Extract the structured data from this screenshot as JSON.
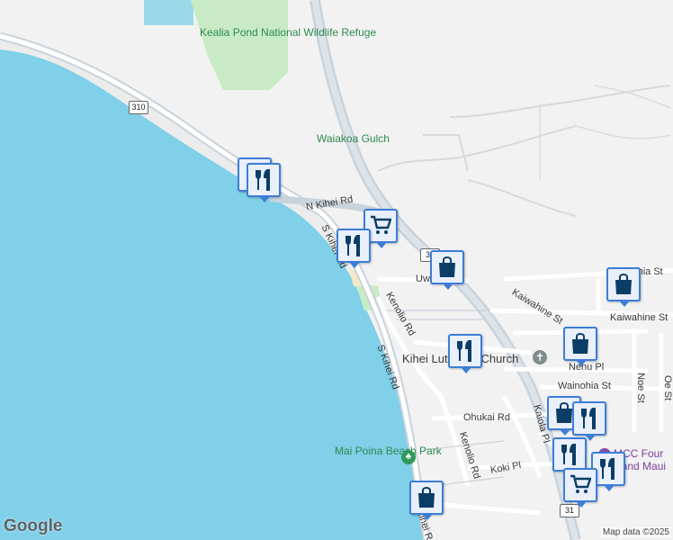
{
  "map": {
    "colors": {
      "water": "#7fd0e8",
      "land": "#f2f2f2",
      "park": "#c8ebc5",
      "road": "#ffffff",
      "highway": "#c9d3db",
      "pin_border": "#3d7dd8",
      "pin_icon": "#0b3d66"
    }
  },
  "labels": {
    "kealia": "Kealia Pond National Wildlife Refuge",
    "waiakoa": "Waiakoa Gulch",
    "n_kihei": "N Kihei Rd",
    "s_kihei_1": "S Kihei Rd",
    "s_kihei_2": "S Kihei Rd",
    "s_kihei_3": "S Kihei Rd",
    "kenolio_1": "Kenolio Rd",
    "kenolio_2": "Kenolio Rd",
    "kaiolohia": "Kaiolohia St",
    "kaiwahine_1": "Kaiwahine St",
    "kaiwahine_2": "Kaiwahine St",
    "uwa": "Uwa Rd",
    "kihei_lutheran": "Kihei Lutheran Church",
    "nehu": "Nehu Pl",
    "wainohia": "Wainohia St",
    "noe": "Noe St",
    "oe": "Oe St",
    "ohukai": "Ohukai Rd",
    "kaiola": "Kaiola Pl",
    "koki": "Koki Pl",
    "maipoina": "Mai Poina Beach Park",
    "mcc": "MCC Four Hand Maui",
    "m_partial": "M"
  },
  "shields": {
    "r310": "310",
    "r31a": "31",
    "r31b": "31"
  },
  "pins": [
    {
      "icon": "restaurant-icon"
    },
    {
      "icon": "restaurant-icon"
    },
    {
      "icon": "grocery-cart-icon"
    },
    {
      "icon": "restaurant-icon"
    },
    {
      "icon": "shopping-bag-icon"
    },
    {
      "icon": "shopping-bag-icon"
    },
    {
      "icon": "shopping-bag-icon"
    },
    {
      "icon": "restaurant-icon"
    },
    {
      "icon": "shopping-bag-icon"
    },
    {
      "icon": "restaurant-icon"
    },
    {
      "icon": "restaurant-icon"
    },
    {
      "icon": "restaurant-icon"
    },
    {
      "icon": "grocery-cart-icon"
    },
    {
      "icon": "shopping-bag-icon"
    }
  ],
  "footer": {
    "logo": "Google",
    "attribution": "Map data ©2025"
  }
}
